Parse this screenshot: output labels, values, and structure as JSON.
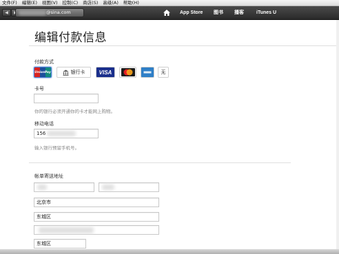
{
  "menu": [
    "文件(F)",
    "编辑(E)",
    "视图(V)",
    "控制(C)",
    "商店(S)",
    "高级(A)",
    "帮助(H)"
  ],
  "nav": {
    "back_label": "◀",
    "forward_label": "▶",
    "account_email_suffix": "@sina.com",
    "items": [
      "App Store",
      "图书",
      "播客",
      "iTunes U"
    ]
  },
  "page": {
    "title": "编辑付款信息"
  },
  "payment": {
    "label": "付款方式",
    "cards": {
      "unionpay": "UnionPay",
      "bankcard": "银行卡",
      "visa": "VISA",
      "none": "无"
    }
  },
  "card_number": {
    "label": "卡号",
    "value": "",
    "hint": "你的银行必须开通你的卡才能网上购物。"
  },
  "mobile": {
    "label": "移动电话",
    "value": "156",
    "hint": "输入银行预留手机号。"
  },
  "billing": {
    "label": "帐单寄送地址",
    "city": "北京市",
    "district": "东城区",
    "street": "",
    "district2": "东城区"
  },
  "colors": {
    "navbar": "#2e2e2e",
    "accent": "#4a7fd4"
  }
}
